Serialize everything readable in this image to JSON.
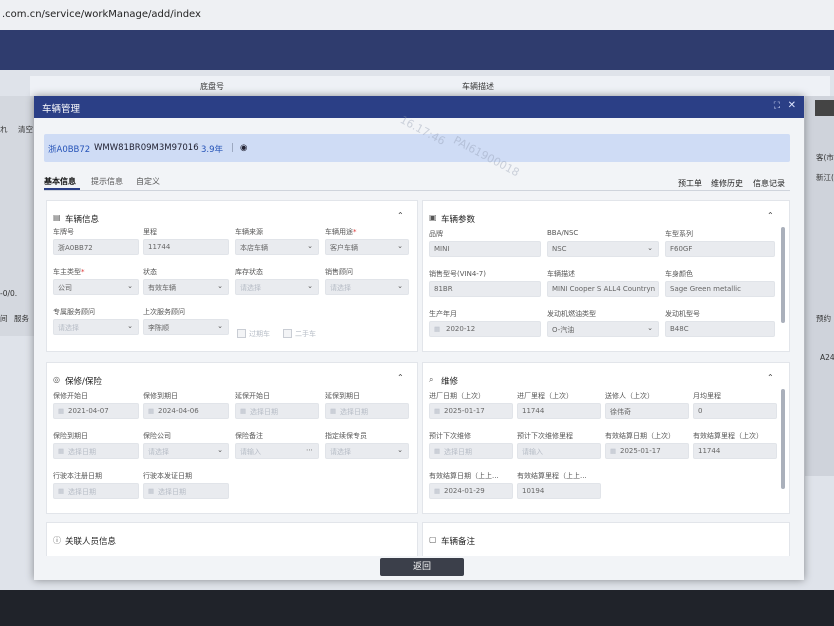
{
  "browser": {
    "url": ".com.cn/service/workManage/add/index"
  },
  "background": {
    "columns": [
      "底盘号",
      "车辆描述"
    ],
    "left_labels": [
      "れ",
      "清空",
      "-0/0.",
      "间",
      "服务"
    ],
    "right_labels": [
      "客(市",
      "新江(",
      "预约",
      "A24"
    ]
  },
  "modal": {
    "title": "车辆管理",
    "summary": {
      "plate": "浙A0BB72",
      "vin": "WMW81BR09M3M97016",
      "years": "3.9年"
    },
    "tabs": [
      "基本信息",
      "提示信息",
      "自定义"
    ],
    "links": [
      "预工单",
      "维修历史",
      "信息记录"
    ],
    "vehicle_info": {
      "title": "车辆信息",
      "fields": [
        {
          "label": "车牌号",
          "value": "浙A0BB72"
        },
        {
          "label": "里程",
          "value": "11744"
        },
        {
          "label": "车辆来源",
          "value": "本店车辆"
        },
        {
          "label": "车辆用途",
          "value": "客户车辆"
        },
        {
          "label": "车主类型",
          "value": "公司"
        },
        {
          "label": "状态",
          "value": "有效车辆"
        },
        {
          "label": "库存状态",
          "value": "请选择"
        },
        {
          "label": "销售顾问",
          "value": "请选择"
        },
        {
          "label": "专属服务顾问",
          "value": "请选择"
        },
        {
          "label": "上次服务顾问",
          "value": "李陈顺"
        }
      ],
      "checkboxes": [
        "过期车",
        "二手车"
      ]
    },
    "vehicle_params": {
      "title": "车辆参数",
      "fields": [
        {
          "label": "品牌",
          "value": "MINI"
        },
        {
          "label": "BBA/NSC",
          "value": "NSC"
        },
        {
          "label": "车型系列",
          "value": "F60GF"
        },
        {
          "label": "销售型号(VIN4-7)",
          "value": "81BR"
        },
        {
          "label": "车辆描述",
          "value": "MINI Cooper S ALL4 Countryn"
        },
        {
          "label": "车身颜色",
          "value": "Sage Green metallic"
        },
        {
          "label": "生产年月",
          "value": "2020-12"
        },
        {
          "label": "发动机燃油类型",
          "value": "O-汽油"
        },
        {
          "label": "发动机型号",
          "value": "B48C"
        }
      ]
    },
    "warranty": {
      "title": "保修/保险",
      "fields": [
        {
          "label": "保修开始日",
          "value": "2021-04-07"
        },
        {
          "label": "保修到期日",
          "value": "2024-04-06"
        },
        {
          "label": "延保开始日",
          "value": "选择日期"
        },
        {
          "label": "延保到期日",
          "value": "选择日期"
        },
        {
          "label": "保险到期日",
          "value": "选择日期"
        },
        {
          "label": "保险公司",
          "value": "请选择"
        },
        {
          "label": "保险备注",
          "value": "请输入"
        },
        {
          "label": "指定续保专员",
          "value": "请选择"
        },
        {
          "label": "行驶本注册日期",
          "value": "选择日期"
        },
        {
          "label": "行驶本发证日期",
          "value": "选择日期"
        }
      ]
    },
    "maintenance": {
      "title": "维修",
      "fields": [
        {
          "label": "进厂日期（上次）",
          "value": "2025-01-17"
        },
        {
          "label": "进厂里程（上次）",
          "value": "11744"
        },
        {
          "label": "送修人（上次）",
          "value": "徐伟奇"
        },
        {
          "label": "月均里程",
          "value": "0"
        },
        {
          "label": "预计下次维修",
          "value": "选择日期"
        },
        {
          "label": "预计下次维修里程",
          "value": "请输入"
        },
        {
          "label": "有效结算日期（上次）",
          "value": "2025-01-17"
        },
        {
          "label": "有效结算里程（上次）",
          "value": "11744"
        },
        {
          "label": "有效结算日期（上上...",
          "value": "2024-01-29"
        },
        {
          "label": "有效结算里程（上上...",
          "value": "10194"
        }
      ]
    },
    "related": {
      "title": "关联人员信息"
    },
    "remarks": {
      "title": "车辆备注"
    },
    "back_label": "返回"
  },
  "watermark": {
    "line1": "16.17:46",
    "line2": "PAI61900018"
  }
}
